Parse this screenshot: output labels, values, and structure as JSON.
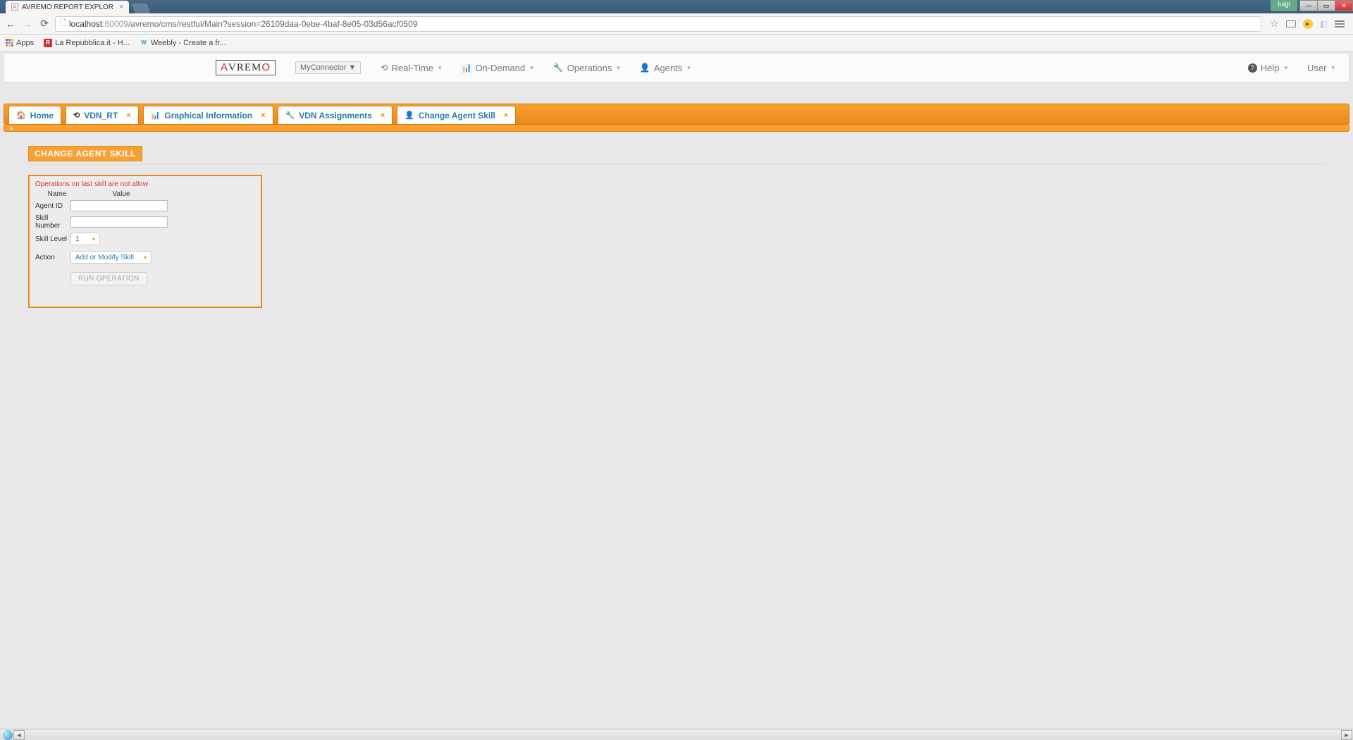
{
  "browser": {
    "tab_title": "AVREMO REPORT EXPLOR",
    "url_host": "localhost",
    "url_port": ":60009",
    "url_path": "/avremo/cms/restful/Main?session=26109daa-0ebe-4baf-8e05-03d56acf0509",
    "win_user": "luigi"
  },
  "bookmarks": {
    "apps": "Apps",
    "items": [
      {
        "label": "La Repubblica.it - H..."
      },
      {
        "label": "Weebly - Create a fr..."
      }
    ]
  },
  "header": {
    "connector": "MyConnector",
    "menus": {
      "realtime": "Real-Time",
      "ondemand": "On-Demand",
      "operations": "Operations",
      "agents": "Agents",
      "help": "Help",
      "user": "User"
    }
  },
  "tabs": [
    {
      "label": "Home",
      "icon": "home",
      "closable": false
    },
    {
      "label": "VDN_RT",
      "icon": "refresh",
      "closable": true
    },
    {
      "label": "Graphical Information",
      "icon": "chart",
      "closable": true
    },
    {
      "label": "VDN Assignments",
      "icon": "wrench",
      "closable": true
    },
    {
      "label": "Change Agent Skill",
      "icon": "user",
      "closable": true
    }
  ],
  "page": {
    "title": "CHANGE AGENT SKILL",
    "warning": "Operations on last skill are not allow",
    "col_name": "Name",
    "col_value": "Value",
    "fields": {
      "agent_id_label": "Agent ID",
      "agent_id_value": "",
      "skill_number_label": "Skill Number",
      "skill_number_value": "",
      "skill_level_label": "Skill Level",
      "skill_level_value": "1",
      "action_label": "Action",
      "action_value": "Add or Modify Skill"
    },
    "run_button": "RUN OPERATION"
  }
}
